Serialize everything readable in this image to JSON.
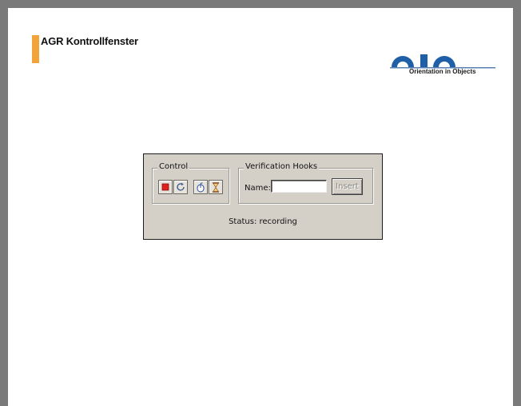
{
  "slide": {
    "title": "AGR Kontrollfenster",
    "logo_tagline": "Orientation in Objects",
    "colors": {
      "accent": "#f2a33a",
      "logo_blue": "#1f5fa8",
      "background": "#7a7a7a"
    }
  },
  "dialog": {
    "control_group": {
      "label": "Control",
      "buttons": [
        {
          "icon": "stop-icon",
          "color": "#e02020"
        },
        {
          "icon": "refresh-icon"
        },
        {
          "icon": "mouse-icon"
        },
        {
          "icon": "hourglass-icon"
        }
      ]
    },
    "hooks_group": {
      "label": "Verification Hooks",
      "name_label": "Name:",
      "name_value": "",
      "insert_label": "Insert"
    },
    "status": "Status: recording",
    "colors": {
      "face": "#d4d0c8"
    }
  }
}
